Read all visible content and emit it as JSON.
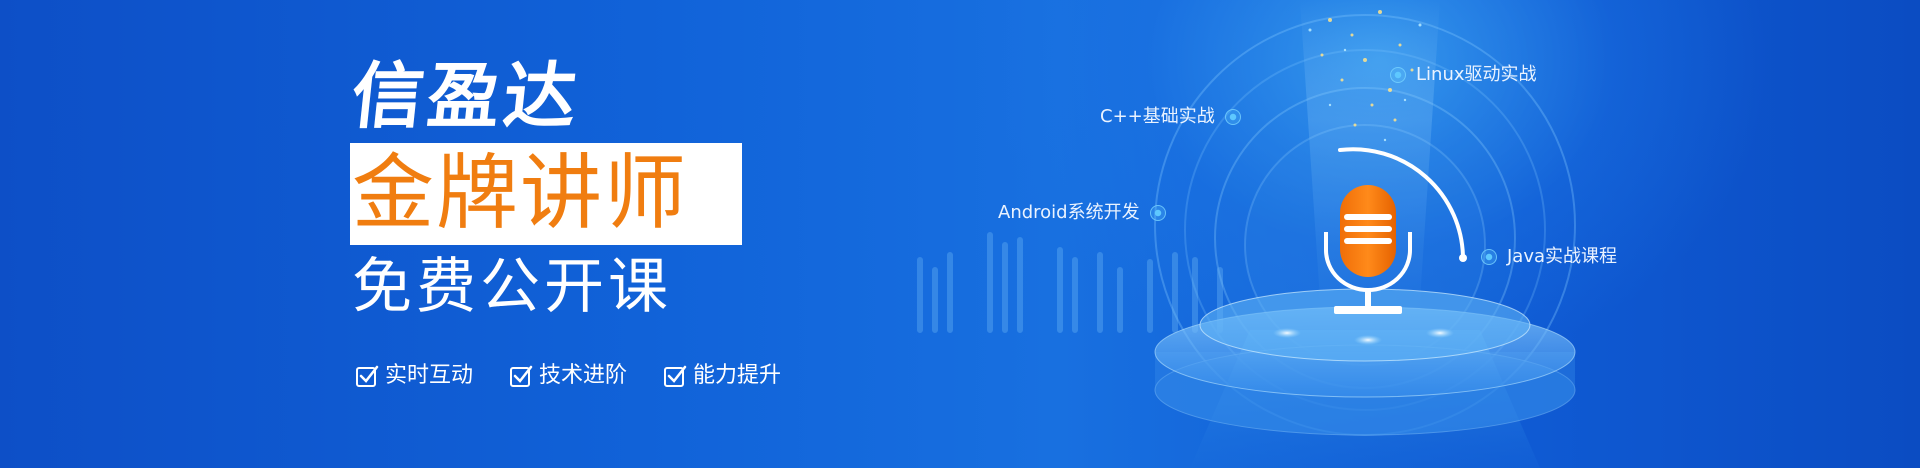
{
  "banner": {
    "brand": "信盈达",
    "headline": "金牌讲师",
    "subline": "免费公开课",
    "features": [
      {
        "label": "实时互动",
        "icon": "checkbox-icon"
      },
      {
        "label": "技术进阶",
        "icon": "checkbox-icon"
      },
      {
        "label": "能力提升",
        "icon": "checkbox-icon"
      }
    ],
    "topics": {
      "linux": "Linux驱动实战",
      "cpp": "C++基础实战",
      "android": "Android系统开发",
      "java": "Java实战课程"
    },
    "colors": {
      "background": "#0e5bd0",
      "accent": "#f07d10",
      "text": "#ffffff",
      "glow": "#5ec8ff"
    },
    "illustration": "microphone-on-stage-icon"
  }
}
